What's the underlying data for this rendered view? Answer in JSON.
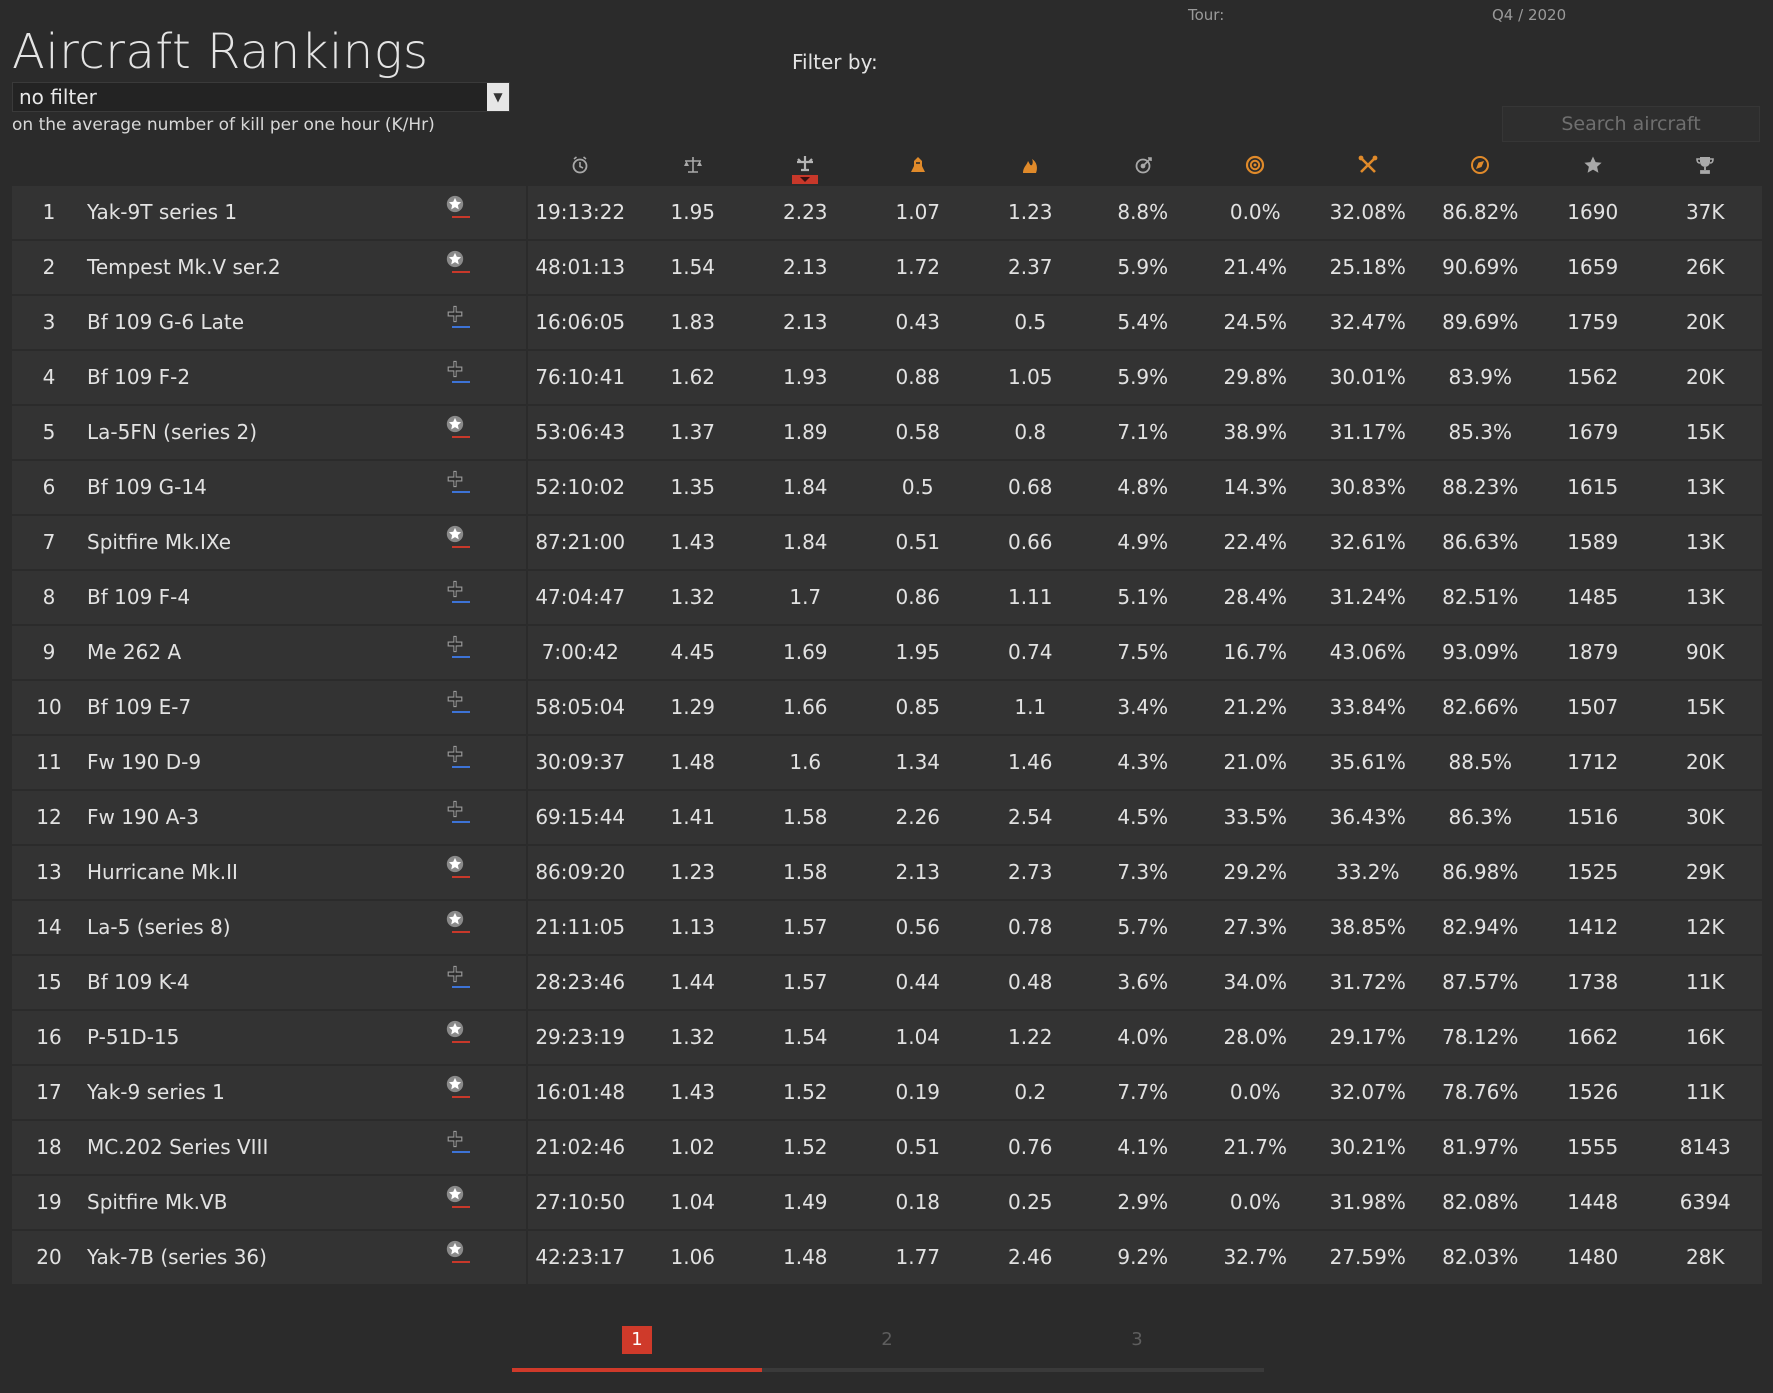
{
  "header": {
    "tour_label": "Tour:",
    "tour_value": "Q4 / 2020",
    "title": "Aircraft Rankings",
    "filter_by_label": "Filter by:",
    "filter_selected": "no filter",
    "metric_description": "on the average number of kill per one hour (K/Hr)",
    "search_placeholder": "Search aircraft"
  },
  "columns": [
    {
      "icon": "clock-icon"
    },
    {
      "icon": "balance-scale-icon"
    },
    {
      "icon": "aircraft-kills-per-hour-icon",
      "sorted": true
    },
    {
      "icon": "ground-target-icon"
    },
    {
      "icon": "flame-target-icon"
    },
    {
      "icon": "accuracy-icon"
    },
    {
      "icon": "bailout-icon"
    },
    {
      "icon": "crossed-wrenches-icon"
    },
    {
      "icon": "compass-icon"
    },
    {
      "icon": "star-icon"
    },
    {
      "icon": "trophy-icon"
    }
  ],
  "rows": [
    {
      "rank": "1",
      "name": "Yak-9T series 1",
      "nation": "star",
      "v": [
        "19:13:22",
        "1.95",
        "2.23",
        "1.07",
        "1.23",
        "8.8%",
        "0.0%",
        "32.08%",
        "86.82%",
        "1690",
        "37K"
      ]
    },
    {
      "rank": "2",
      "name": "Tempest Mk.V ser.2",
      "nation": "star",
      "v": [
        "48:01:13",
        "1.54",
        "2.13",
        "1.72",
        "2.37",
        "5.9%",
        "21.4%",
        "25.18%",
        "90.69%",
        "1659",
        "26K"
      ]
    },
    {
      "rank": "3",
      "name": "Bf 109 G-6 Late",
      "nation": "cross",
      "v": [
        "16:06:05",
        "1.83",
        "2.13",
        "0.43",
        "0.5",
        "5.4%",
        "24.5%",
        "32.47%",
        "89.69%",
        "1759",
        "20K"
      ]
    },
    {
      "rank": "4",
      "name": "Bf 109 F-2",
      "nation": "cross",
      "v": [
        "76:10:41",
        "1.62",
        "1.93",
        "0.88",
        "1.05",
        "5.9%",
        "29.8%",
        "30.01%",
        "83.9%",
        "1562",
        "20K"
      ]
    },
    {
      "rank": "5",
      "name": "La-5FN (series 2)",
      "nation": "star",
      "v": [
        "53:06:43",
        "1.37",
        "1.89",
        "0.58",
        "0.8",
        "7.1%",
        "38.9%",
        "31.17%",
        "85.3%",
        "1679",
        "15K"
      ]
    },
    {
      "rank": "6",
      "name": "Bf 109 G-14",
      "nation": "cross",
      "v": [
        "52:10:02",
        "1.35",
        "1.84",
        "0.5",
        "0.68",
        "4.8%",
        "14.3%",
        "30.83%",
        "88.23%",
        "1615",
        "13K"
      ]
    },
    {
      "rank": "7",
      "name": "Spitfire Mk.IXe",
      "nation": "star",
      "v": [
        "87:21:00",
        "1.43",
        "1.84",
        "0.51",
        "0.66",
        "4.9%",
        "22.4%",
        "32.61%",
        "86.63%",
        "1589",
        "13K"
      ]
    },
    {
      "rank": "8",
      "name": "Bf 109 F-4",
      "nation": "cross",
      "v": [
        "47:04:47",
        "1.32",
        "1.7",
        "0.86",
        "1.11",
        "5.1%",
        "28.4%",
        "31.24%",
        "82.51%",
        "1485",
        "13K"
      ]
    },
    {
      "rank": "9",
      "name": "Me 262 A",
      "nation": "cross",
      "v": [
        "7:00:42",
        "4.45",
        "1.69",
        "1.95",
        "0.74",
        "7.5%",
        "16.7%",
        "43.06%",
        "93.09%",
        "1879",
        "90K"
      ]
    },
    {
      "rank": "10",
      "name": "Bf 109 E-7",
      "nation": "cross",
      "v": [
        "58:05:04",
        "1.29",
        "1.66",
        "0.85",
        "1.1",
        "3.4%",
        "21.2%",
        "33.84%",
        "82.66%",
        "1507",
        "15K"
      ]
    },
    {
      "rank": "11",
      "name": "Fw 190 D-9",
      "nation": "cross",
      "v": [
        "30:09:37",
        "1.48",
        "1.6",
        "1.34",
        "1.46",
        "4.3%",
        "21.0%",
        "35.61%",
        "88.5%",
        "1712",
        "20K"
      ]
    },
    {
      "rank": "12",
      "name": "Fw 190 A-3",
      "nation": "cross",
      "v": [
        "69:15:44",
        "1.41",
        "1.58",
        "2.26",
        "2.54",
        "4.5%",
        "33.5%",
        "36.43%",
        "86.3%",
        "1516",
        "30K"
      ]
    },
    {
      "rank": "13",
      "name": "Hurricane Mk.II",
      "nation": "star",
      "v": [
        "86:09:20",
        "1.23",
        "1.58",
        "2.13",
        "2.73",
        "7.3%",
        "29.2%",
        "33.2%",
        "86.98%",
        "1525",
        "29K"
      ]
    },
    {
      "rank": "14",
      "name": "La-5 (series 8)",
      "nation": "star",
      "v": [
        "21:11:05",
        "1.13",
        "1.57",
        "0.56",
        "0.78",
        "5.7%",
        "27.3%",
        "38.85%",
        "82.94%",
        "1412",
        "12K"
      ]
    },
    {
      "rank": "15",
      "name": "Bf 109 K-4",
      "nation": "cross",
      "v": [
        "28:23:46",
        "1.44",
        "1.57",
        "0.44",
        "0.48",
        "3.6%",
        "34.0%",
        "31.72%",
        "87.57%",
        "1738",
        "11K"
      ]
    },
    {
      "rank": "16",
      "name": "P-51D-15",
      "nation": "star",
      "v": [
        "29:23:19",
        "1.32",
        "1.54",
        "1.04",
        "1.22",
        "4.0%",
        "28.0%",
        "29.17%",
        "78.12%",
        "1662",
        "16K"
      ]
    },
    {
      "rank": "17",
      "name": "Yak-9 series 1",
      "nation": "star",
      "v": [
        "16:01:48",
        "1.43",
        "1.52",
        "0.19",
        "0.2",
        "7.7%",
        "0.0%",
        "32.07%",
        "78.76%",
        "1526",
        "11K"
      ]
    },
    {
      "rank": "18",
      "name": "MC.202 Series VIII",
      "nation": "cross",
      "v": [
        "21:02:46",
        "1.02",
        "1.52",
        "0.51",
        "0.76",
        "4.1%",
        "21.7%",
        "30.21%",
        "81.97%",
        "1555",
        "8143"
      ]
    },
    {
      "rank": "19",
      "name": "Spitfire Mk.VB",
      "nation": "star",
      "v": [
        "27:10:50",
        "1.04",
        "1.49",
        "0.18",
        "0.25",
        "2.9%",
        "0.0%",
        "31.98%",
        "82.08%",
        "1448",
        "6394"
      ]
    },
    {
      "rank": "20",
      "name": "Yak-7B (series 36)",
      "nation": "star",
      "v": [
        "42:23:17",
        "1.06",
        "1.48",
        "1.77",
        "2.46",
        "9.2%",
        "32.7%",
        "27.59%",
        "82.03%",
        "1480",
        "28K"
      ]
    }
  ],
  "pagination": {
    "pages": [
      "1",
      "2",
      "3"
    ],
    "current": "1",
    "progress_fraction": 0.333
  },
  "colors": {
    "accent": "#cf3a2a",
    "allied_underline": "#c8382a",
    "axis_underline": "#3d73d6",
    "icon_orange": "#e08a2a"
  }
}
